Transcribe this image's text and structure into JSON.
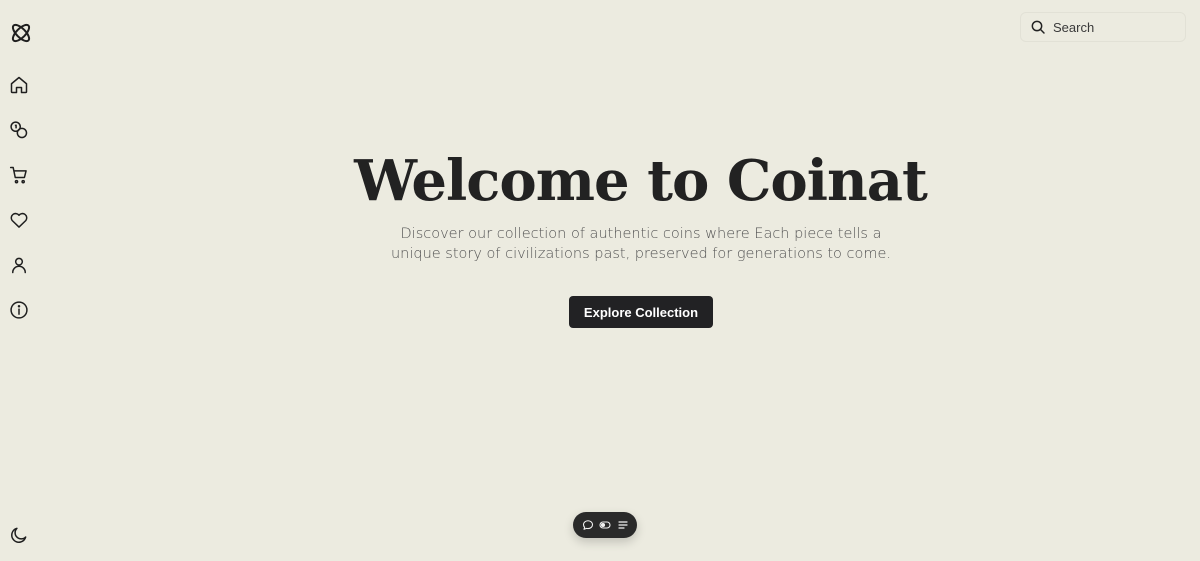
{
  "brand": {
    "logo_icon": "atom-logo-icon"
  },
  "sidebar": {
    "items": [
      {
        "name": "home",
        "icon": "home-icon"
      },
      {
        "name": "coins",
        "icon": "coins-icon"
      },
      {
        "name": "cart",
        "icon": "cart-icon"
      },
      {
        "name": "wishlist",
        "icon": "heart-icon"
      },
      {
        "name": "account",
        "icon": "user-icon"
      },
      {
        "name": "about",
        "icon": "info-icon"
      }
    ],
    "theme_toggle_icon": "moon-icon"
  },
  "search": {
    "placeholder": "Search"
  },
  "hero": {
    "title": "Welcome to Coinat",
    "subtitle": "Discover our collection of authentic coins where Each piece tells a unique story of civilizations past, preserved for generations to come.",
    "cta_label": "Explore Collection"
  },
  "toolbar": {
    "items": [
      "chat-icon",
      "toggle-icon",
      "menu-icon"
    ]
  },
  "colors": {
    "background": "#ecebe0",
    "text": "#222222",
    "button_bg": "#222224",
    "toolbar_bg": "#2a2a2a"
  }
}
